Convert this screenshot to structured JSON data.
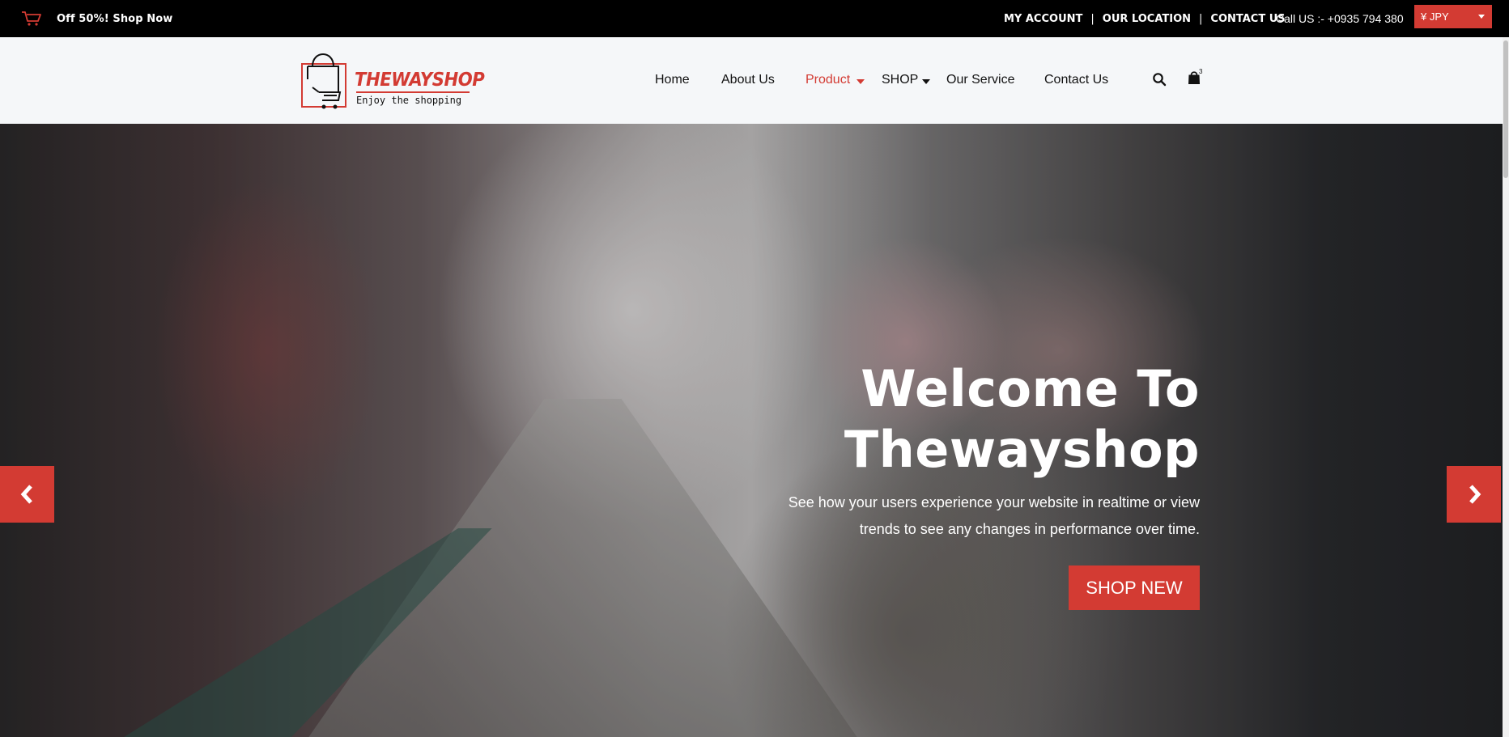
{
  "topbar": {
    "promo_text": "Off 50%! Shop Now",
    "links": [
      {
        "label": "MY ACCOUNT"
      },
      {
        "label": "OUR LOCATION"
      },
      {
        "label": "CONTACT US"
      }
    ],
    "separator": "|",
    "call_us": "Call US :- +0935 794 380",
    "currency": "¥ JPY"
  },
  "brand": {
    "name": "THEWAYSHOP",
    "tagline": "Enjoy the shopping",
    "accent_color": "#d33b33"
  },
  "nav": {
    "items": [
      {
        "label": "Home",
        "active": false,
        "dropdown": false
      },
      {
        "label": "About Us",
        "active": false,
        "dropdown": false
      },
      {
        "label": "Product",
        "active": true,
        "dropdown": true
      },
      {
        "label": "SHOP",
        "active": false,
        "dropdown": true
      },
      {
        "label": "Our Service",
        "active": false,
        "dropdown": false
      },
      {
        "label": "Contact Us",
        "active": false,
        "dropdown": false
      }
    ],
    "cart_count": "3",
    "icons": [
      "search-icon",
      "shopping-bag-icon"
    ]
  },
  "hero": {
    "title_line1": "Welcome To",
    "title_line2": "Thewayshop",
    "subtitle_line1": "See how your users experience your website in realtime or view",
    "subtitle_line2": "trends to see any changes in performance over time.",
    "cta_label": "SHOP NEW",
    "prev_icon": "chevron-left-icon",
    "next_icon": "chevron-right-icon"
  }
}
